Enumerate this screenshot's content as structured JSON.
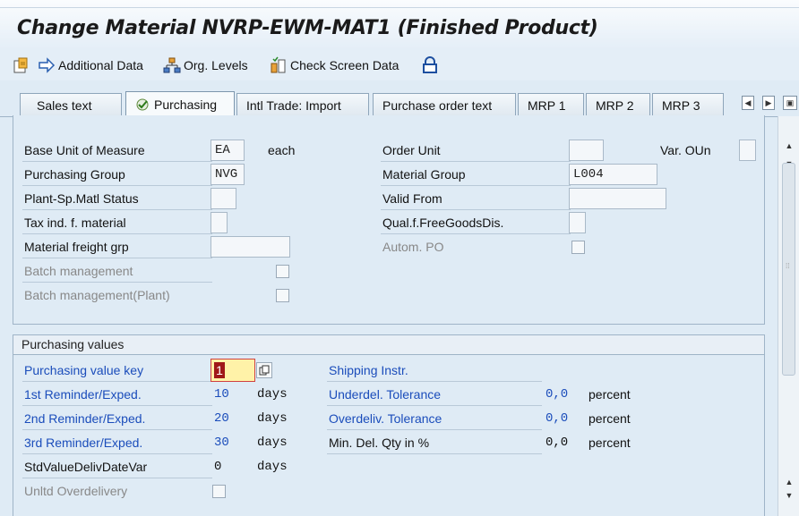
{
  "window": {
    "title": "Change Material NVRP-EWM-MAT1 (Finished Product)"
  },
  "toolbar": {
    "additional_data": "Additional Data",
    "org_levels": "Org. Levels",
    "check_screen_data": "Check Screen Data"
  },
  "tabs": [
    {
      "label": "Sales text"
    },
    {
      "label": "Purchasing"
    },
    {
      "label": "Intl Trade: Import"
    },
    {
      "label": "Purchase order text"
    },
    {
      "label": "MRP 1"
    },
    {
      "label": "MRP 2"
    },
    {
      "label": "MRP 3"
    }
  ],
  "general": {
    "base_uom_label": "Base Unit of Measure",
    "base_uom_value": "EA",
    "base_uom_text": "each",
    "order_unit_label": "Order Unit",
    "order_unit_value": "",
    "var_oun_label": "Var. OUn",
    "purchasing_group_label": "Purchasing Group",
    "purchasing_group_value": "NVG",
    "material_group_label": "Material Group",
    "material_group_value": "L004",
    "plant_status_label": "Plant-Sp.Matl Status",
    "plant_status_value": "",
    "valid_from_label": "Valid From",
    "valid_from_value": "",
    "tax_ind_label": "Tax ind. f. material",
    "tax_ind_value": "",
    "qual_free_label": "Qual.f.FreeGoodsDis.",
    "qual_free_value": "",
    "freight_grp_label": "Material freight grp",
    "freight_grp_value": "",
    "autom_po_label": "Autom. PO",
    "batch_mgmt_label": "Batch management",
    "batch_mgmt_plant_label": "Batch management(Plant)"
  },
  "purchasing_values": {
    "title": "Purchasing values",
    "value_key_label": "Purchasing value key",
    "value_key_value": "1",
    "shipping_instr_label": "Shipping Instr.",
    "reminder1_label": "1st Reminder/Exped.",
    "reminder1_value": "10",
    "reminder2_label": "2nd Reminder/Exped.",
    "reminder2_value": "20",
    "reminder3_label": "3rd Reminder/Exped.",
    "reminder3_value": "30",
    "std_deliv_label": "StdValueDelivDateVar",
    "std_deliv_value": "0",
    "days_unit": "days",
    "underdel_label": "Underdel. Tolerance",
    "underdel_value": "0,0",
    "overdel_label": "Overdeliv. Tolerance",
    "overdel_value": "0,0",
    "min_del_label": "Min. Del. Qty in %",
    "min_del_value": "0,0",
    "percent_unit": "percent",
    "unltd_overdel_label": "Unltd Overdelivery"
  }
}
